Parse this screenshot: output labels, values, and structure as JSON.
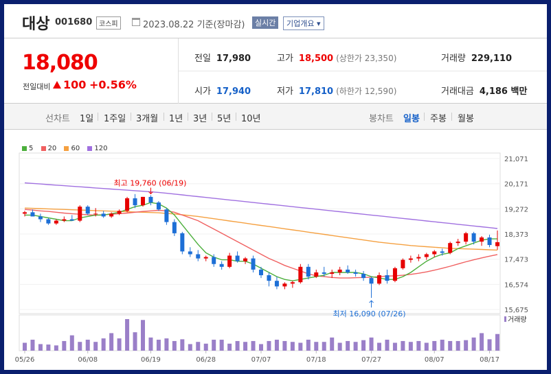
{
  "header": {
    "stock_name": "대상",
    "stock_code": "001680",
    "market_badge": "코스피",
    "date_text": "2023.08.22 기준(장마감)",
    "realtime_button": "실시간",
    "company_info_button": "기업개요"
  },
  "price": {
    "current": "18,080",
    "change_label": "전일대비",
    "change_value": "100",
    "change_percent": "+0.56%"
  },
  "stats": {
    "prev_close_label": "전일",
    "prev_close": "17,980",
    "high_label": "고가",
    "high": "18,500",
    "upper_limit": "(상한가 23,350)",
    "volume_label": "거래량",
    "volume": "229,110",
    "open_label": "시가",
    "open": "17,940",
    "low_label": "저가",
    "low": "17,810",
    "lower_limit": "(하한가 12,590)",
    "amount_label": "거래대금",
    "amount": "4,186 백만"
  },
  "tabs": {
    "line_chart_label": "선차트",
    "periods": [
      "1일",
      "1주일",
      "3개월",
      "1년",
      "3년",
      "5년",
      "10년"
    ],
    "candle_chart_label": "봉차트",
    "candle_periods": [
      "일봉",
      "주봉",
      "월봉"
    ],
    "active_candle": "일봉"
  },
  "colors": {
    "up": "#e60000",
    "down": "#1d6fd6",
    "ma5": "#4caf3c",
    "ma20": "#f06060",
    "ma60": "#f5a040",
    "ma120": "#a070e0",
    "volume": "#9a7fc8"
  },
  "chart_data": {
    "type": "candlestick",
    "legend": [
      "5",
      "20",
      "60",
      "120"
    ],
    "y_ticks": [
      "21,071",
      "20,171",
      "19,272",
      "18,373",
      "17,473",
      "16,574",
      "15,675"
    ],
    "ylim": [
      15675,
      21071
    ],
    "x_ticks": [
      "05/26",
      "06/08",
      "06/19",
      "06/28",
      "07/07",
      "07/18",
      "07/27",
      "08/07",
      "08/17"
    ],
    "annotations": {
      "high": "최고 19,760 (06/19)",
      "low": "최저 16,090 (07/26)"
    },
    "volume_label": "거래량",
    "candles": [
      [
        19100,
        19200,
        19000,
        19150
      ],
      [
        19150,
        19250,
        19050,
        19000
      ],
      [
        19000,
        19100,
        18800,
        18900
      ],
      [
        18900,
        18950,
        18700,
        18750
      ],
      [
        18750,
        18900,
        18700,
        18850
      ],
      [
        18850,
        19000,
        18800,
        18900
      ],
      [
        18900,
        19050,
        18850,
        18850
      ],
      [
        18850,
        19400,
        18800,
        19350
      ],
      [
        19350,
        19400,
        19050,
        19100
      ],
      [
        19100,
        19300,
        19000,
        19100
      ],
      [
        19100,
        19200,
        18950,
        19000
      ],
      [
        19000,
        19150,
        18950,
        19100
      ],
      [
        19100,
        19250,
        19050,
        19200
      ],
      [
        19200,
        19700,
        19150,
        19650
      ],
      [
        19650,
        19800,
        19300,
        19400
      ],
      [
        19400,
        19700,
        19350,
        19700
      ],
      [
        19700,
        19760,
        19400,
        19500
      ],
      [
        19500,
        19550,
        19200,
        19250
      ],
      [
        19250,
        19300,
        18700,
        18800
      ],
      [
        18800,
        18900,
        18300,
        18400
      ],
      [
        18400,
        18450,
        17650,
        17750
      ],
      [
        17750,
        17900,
        17550,
        17650
      ],
      [
        17650,
        17800,
        17400,
        17500
      ],
      [
        17500,
        17600,
        17400,
        17550
      ],
      [
        17550,
        17650,
        17200,
        17300
      ],
      [
        17300,
        17400,
        17100,
        17200
      ],
      [
        17200,
        17700,
        17150,
        17600
      ],
      [
        17600,
        17750,
        17350,
        17400
      ],
      [
        17400,
        17550,
        17300,
        17500
      ],
      [
        17500,
        17600,
        17000,
        17100
      ],
      [
        17100,
        17200,
        16800,
        16900
      ],
      [
        16900,
        17000,
        16500,
        16700
      ],
      [
        16700,
        16850,
        16400,
        16500
      ],
      [
        16500,
        16650,
        16400,
        16600
      ],
      [
        16600,
        16700,
        16450,
        16650
      ],
      [
        16650,
        17300,
        16600,
        17200
      ],
      [
        17200,
        17300,
        16750,
        16850
      ],
      [
        16850,
        17100,
        16800,
        17000
      ],
      [
        17000,
        17200,
        16850,
        16950
      ],
      [
        16950,
        17100,
        16800,
        17000
      ],
      [
        17000,
        17200,
        16900,
        17100
      ],
      [
        17100,
        17250,
        16950,
        17000
      ],
      [
        17000,
        17100,
        16850,
        16950
      ],
      [
        16950,
        17050,
        16700,
        16800
      ],
      [
        16800,
        16850,
        16090,
        16600
      ],
      [
        16600,
        17000,
        16550,
        16900
      ],
      [
        16900,
        17100,
        16600,
        16700
      ],
      [
        16700,
        17200,
        16650,
        17150
      ],
      [
        17150,
        17500,
        17100,
        17450
      ],
      [
        17450,
        17600,
        17350,
        17500
      ],
      [
        17500,
        17650,
        17400,
        17550
      ],
      [
        17550,
        17700,
        17450,
        17650
      ],
      [
        17650,
        17800,
        17550,
        17750
      ],
      [
        17750,
        17850,
        17600,
        17700
      ],
      [
        17700,
        18100,
        17650,
        18050
      ],
      [
        18050,
        18200,
        17950,
        18100
      ],
      [
        18100,
        18450,
        18000,
        18400
      ],
      [
        18400,
        18450,
        18000,
        18100
      ],
      [
        18100,
        18300,
        17950,
        18250
      ],
      [
        18250,
        18350,
        17900,
        17980
      ],
      [
        17940,
        18500,
        17810,
        18080
      ]
    ],
    "ma5": [
      19050,
      19050,
      19000,
      18950,
      18900,
      18850,
      18850,
      18950,
      19000,
      19050,
      19050,
      19100,
      19150,
      19250,
      19350,
      19400,
      19500,
      19450,
      19300,
      19050,
      18700,
      18350,
      18000,
      17700,
      17550,
      17450,
      17450,
      17400,
      17400,
      17300,
      17150,
      17000,
      16850,
      16750,
      16700,
      16750,
      16800,
      16850,
      16900,
      17000,
      17000,
      17000,
      17000,
      16950,
      16850,
      16800,
      16750,
      16750,
      16850,
      17000,
      17200,
      17400,
      17550,
      17650,
      17700,
      17850,
      17950,
      18050,
      18150,
      18200,
      18200
    ],
    "ma20": [
      19250,
      19230,
      19200,
      19180,
      19150,
      19120,
      19100,
      19080,
      19060,
      19050,
      19060,
      19080,
      19100,
      19120,
      19150,
      19180,
      19200,
      19220,
      19200,
      19150,
      19050,
      18950,
      18850,
      18700,
      18550,
      18400,
      18250,
      18100,
      17950,
      17800,
      17650,
      17500,
      17380,
      17250,
      17150,
      17050,
      16950,
      16880,
      16850,
      16820,
      16800,
      16800,
      16810,
      16820,
      16830,
      16850,
      16870,
      16880,
      16900,
      16930,
      16970,
      17020,
      17080,
      17150,
      17220,
      17300,
      17380,
      17450,
      17520,
      17580,
      17640
    ],
    "ma60": [
      19300,
      19290,
      19280,
      19270,
      19260,
      19250,
      19240,
      19230,
      19220,
      19210,
      19200,
      19190,
      19180,
      19170,
      19160,
      19150,
      19140,
      19130,
      19110,
      19090,
      19060,
      19030,
      19000,
      18960,
      18920,
      18880,
      18840,
      18800,
      18760,
      18720,
      18680,
      18640,
      18600,
      18560,
      18520,
      18480,
      18440,
      18400,
      18360,
      18320,
      18280,
      18240,
      18200,
      18160,
      18120,
      18080,
      18050,
      18020,
      17990,
      17960,
      17940,
      17920,
      17900,
      17880,
      17860,
      17850,
      17840,
      17830,
      17820,
      17810,
      17800
    ],
    "ma120": [
      20200,
      20180,
      20160,
      20140,
      20120,
      20100,
      20080,
      20060,
      20040,
      20020,
      20000,
      19980,
      19960,
      19940,
      19920,
      19900,
      19880,
      19860,
      19830,
      19800,
      19770,
      19740,
      19710,
      19680,
      19650,
      19620,
      19590,
      19560,
      19530,
      19500,
      19470,
      19440,
      19410,
      19380,
      19350,
      19320,
      19290,
      19260,
      19230,
      19200,
      19170,
      19140,
      19110,
      19080,
      19050,
      19020,
      18990,
      18960,
      18930,
      18900,
      18870,
      18840,
      18810,
      18780,
      18750,
      18720,
      18690,
      18660,
      18630,
      18600,
      18570
    ],
    "volume": [
      18,
      25,
      15,
      14,
      12,
      22,
      35,
      20,
      25,
      20,
      28,
      40,
      28,
      72,
      42,
      70,
      30,
      25,
      28,
      22,
      26,
      15,
      20,
      16,
      25,
      25,
      16,
      22,
      20,
      22,
      15,
      22,
      25,
      22,
      20,
      18,
      25,
      20,
      20,
      30,
      18,
      22,
      20,
      24,
      30,
      18,
      25,
      18,
      22,
      20,
      22,
      18,
      22,
      25,
      22,
      22,
      24,
      30,
      40,
      26,
      38,
      20,
      18,
      35
    ]
  }
}
